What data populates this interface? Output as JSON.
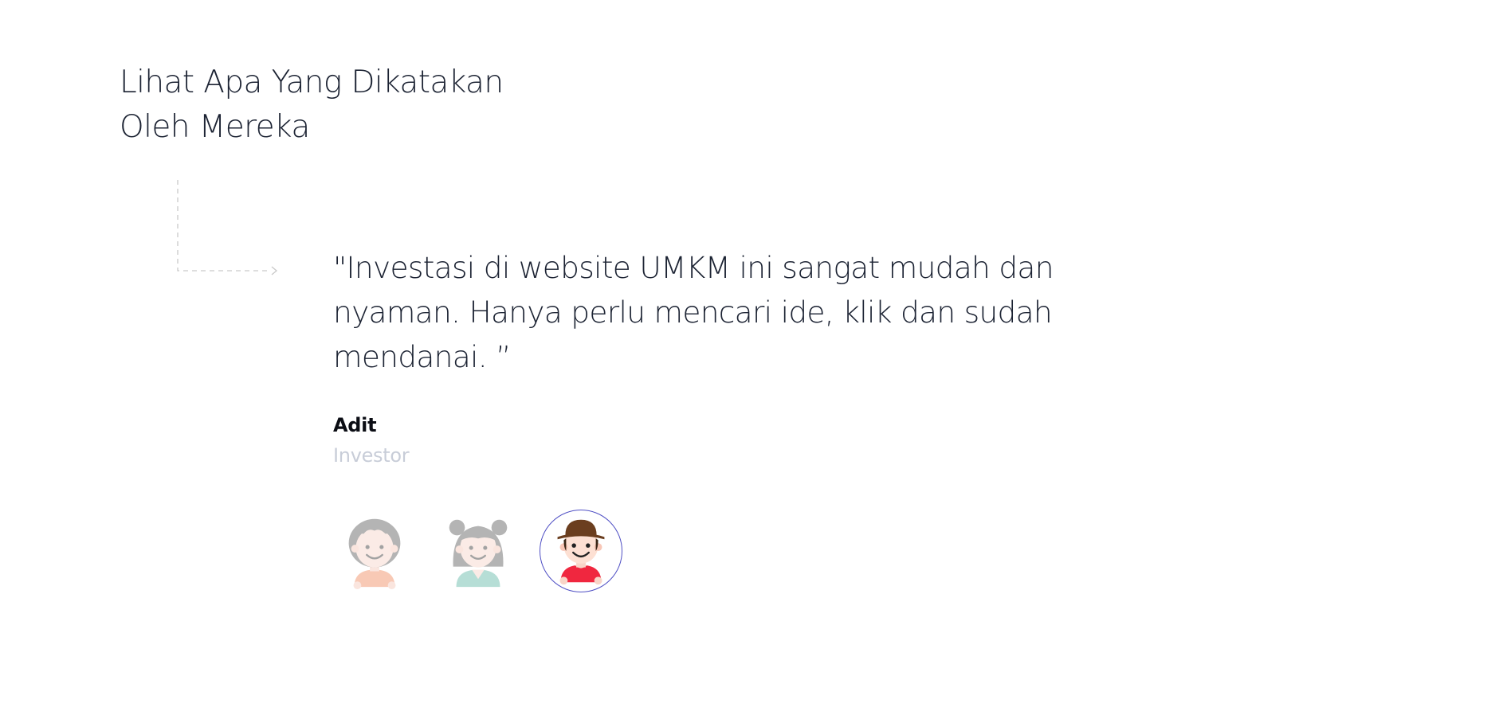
{
  "section": {
    "title_lines": [
      "Lihat Apa Yang Dikatakan",
      "Oleh Mereka"
    ]
  },
  "testimonial": {
    "quote_lines": [
      "\"Investasi di website UMKM ini sangat mudah dan",
      "nyaman. Hanya perlu mencari ide, klik dan sudah",
      "mendanai. ”"
    ],
    "author_name": "Adit",
    "author_role": "Investor"
  },
  "avatars": [
    {
      "icon": "elderly-man-icon",
      "active": false
    },
    {
      "icon": "elderly-woman-icon",
      "active": false
    },
    {
      "icon": "boy-with-hat-icon",
      "active": true
    }
  ],
  "colors": {
    "text_dark": "#1c2333",
    "text_muted": "#c8cdd8",
    "active_ring": "#4f4fc4",
    "connector": "#c9c9c9"
  }
}
